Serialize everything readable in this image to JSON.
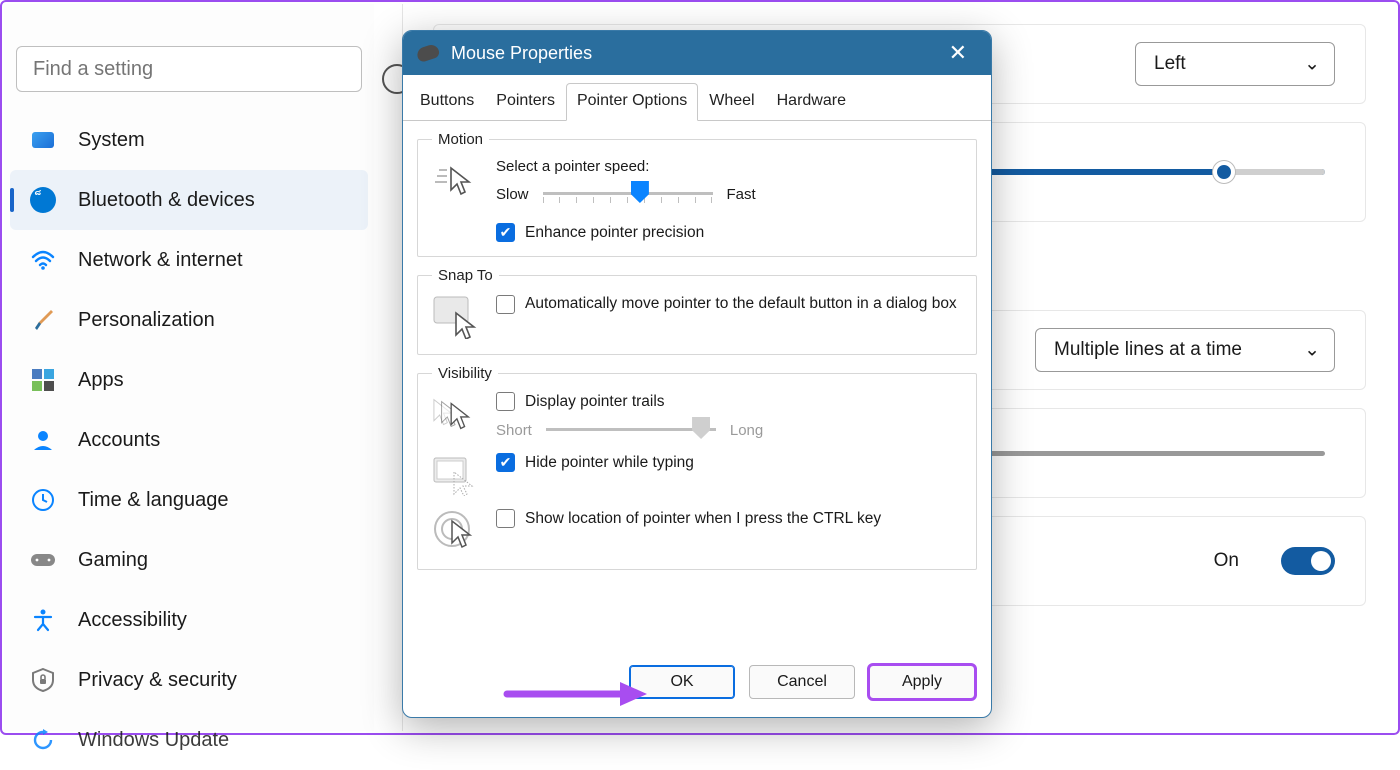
{
  "sidebar": {
    "search_placeholder": "Find a setting",
    "items": [
      {
        "label": "System"
      },
      {
        "label": "Bluetooth & devices"
      },
      {
        "label": "Network & internet"
      },
      {
        "label": "Personalization"
      },
      {
        "label": "Apps"
      },
      {
        "label": "Accounts"
      },
      {
        "label": "Time & language"
      },
      {
        "label": "Gaming"
      },
      {
        "label": "Accessibility"
      },
      {
        "label": "Privacy & security"
      },
      {
        "label": "Windows Update"
      }
    ],
    "active_index": 1
  },
  "main": {
    "primary_button_dropdown": "Left",
    "scroll_dropdown": "Multiple lines at a time",
    "toggle_label": "On"
  },
  "dialog": {
    "title": "Mouse Properties",
    "tabs": [
      "Buttons",
      "Pointers",
      "Pointer Options",
      "Wheel",
      "Hardware"
    ],
    "active_tab_index": 2,
    "motion": {
      "legend": "Motion",
      "speed_label": "Select a pointer speed:",
      "slow": "Slow",
      "fast": "Fast",
      "enhance_label": "Enhance pointer precision",
      "enhance_checked": true
    },
    "snap": {
      "legend": "Snap To",
      "label": "Automatically move pointer to the default button in a dialog box",
      "checked": false
    },
    "visibility": {
      "legend": "Visibility",
      "trails_label": "Display pointer trails",
      "trails_checked": false,
      "short": "Short",
      "long": "Long",
      "hide_label": "Hide pointer while typing",
      "hide_checked": true,
      "ctrl_label": "Show location of pointer when I press the CTRL key",
      "ctrl_checked": false
    },
    "buttons": {
      "ok": "OK",
      "cancel": "Cancel",
      "apply": "Apply"
    }
  }
}
